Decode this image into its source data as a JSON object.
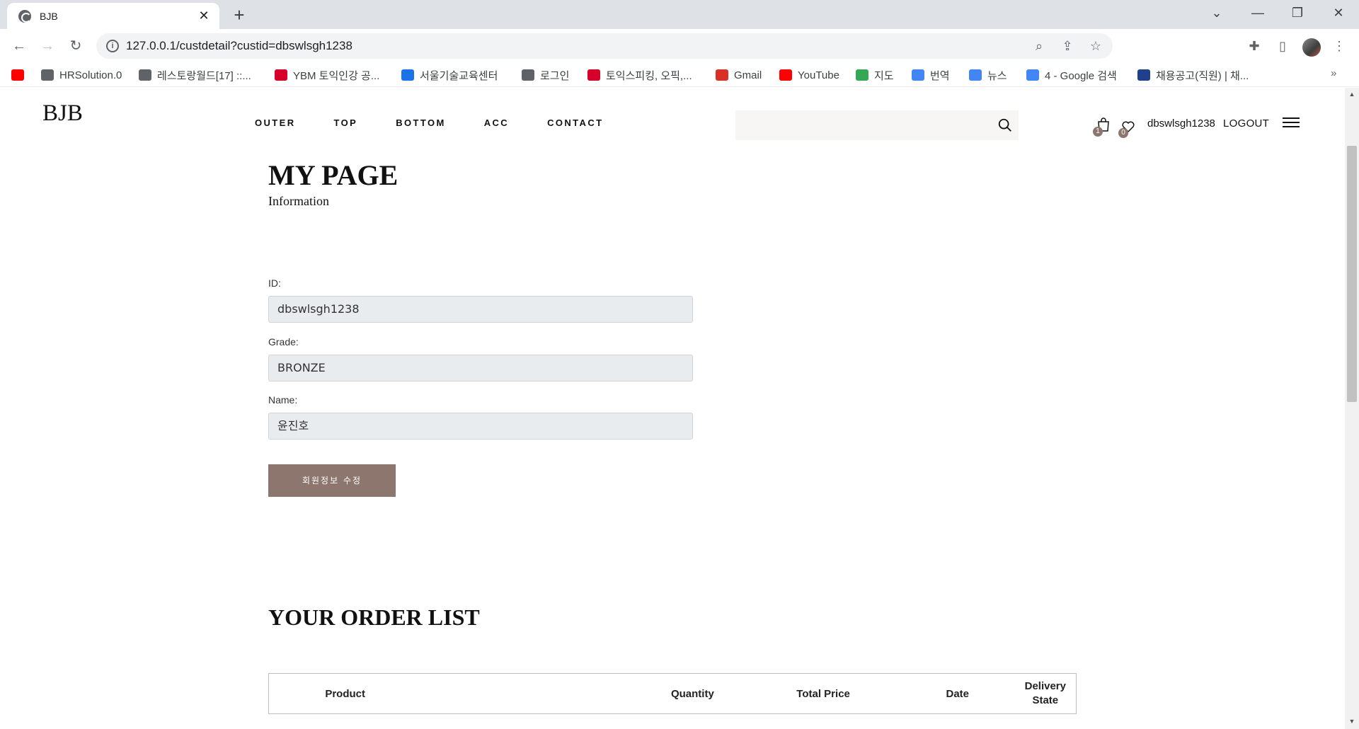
{
  "browser": {
    "tab_title": "BJB",
    "url": "127.0.0.1/custdetail?custid=dbswlsgh1238",
    "bookmarks": [
      {
        "label": "",
        "icon": "youtube-icon",
        "color": "#ff0000"
      },
      {
        "label": "HRSolution.0",
        "icon": "globe-icon",
        "color": "#5f6368"
      },
      {
        "label": "레스토랑월드[17] ::...",
        "icon": "globe-icon",
        "color": "#5f6368"
      },
      {
        "label": "YBM 토익인강 공...",
        "icon": "ybm-icon",
        "color": "#d6002a"
      },
      {
        "label": "서울기술교육센터",
        "icon": "puzzle-logo-icon",
        "color": "#1a73e8"
      },
      {
        "label": "로그인",
        "icon": "globe-icon",
        "color": "#5f6368"
      },
      {
        "label": "토익스피킹, 오픽,...",
        "icon": "ybm-icon",
        "color": "#d6002a"
      },
      {
        "label": "Gmail",
        "icon": "gmail-icon",
        "color": "#d93025"
      },
      {
        "label": "YouTube",
        "icon": "youtube-icon",
        "color": "#ff0000"
      },
      {
        "label": "지도",
        "icon": "maps-icon",
        "color": "#34a853"
      },
      {
        "label": "번역",
        "icon": "translate-icon",
        "color": "#4285f4"
      },
      {
        "label": "뉴스",
        "icon": "news-icon",
        "color": "#4285f4"
      },
      {
        "label": "4 - Google 검색",
        "icon": "google-icon",
        "color": "#4285f4"
      },
      {
        "label": "채용공고(직원) | 채...",
        "icon": "emblem-icon",
        "color": "#1f3f8f"
      }
    ],
    "bookmarks_more": "»"
  },
  "site": {
    "logo": "BJB",
    "nav": [
      "OUTER",
      "TOP",
      "BOTTOM",
      "ACC",
      "CONTACT"
    ],
    "search_placeholder": "",
    "cart_count": "1",
    "wishlist_count": "0",
    "username": "dbswlsgh1238",
    "logout": "LOGOUT",
    "accent_color": "#8d766d"
  },
  "mypage": {
    "title": "MY PAGE",
    "subtitle": "Information",
    "fields": [
      {
        "label": "ID:",
        "value": "dbswlsgh1238"
      },
      {
        "label": "Grade:",
        "value": "BRONZE"
      },
      {
        "label": "Name:",
        "value": "윤진호"
      }
    ],
    "edit_button": "회원정보 수정"
  },
  "orders": {
    "title": "YOUR ORDER LIST",
    "columns": [
      "Product",
      "Quantity",
      "Total Price",
      "Date",
      "Delivery State"
    ]
  }
}
